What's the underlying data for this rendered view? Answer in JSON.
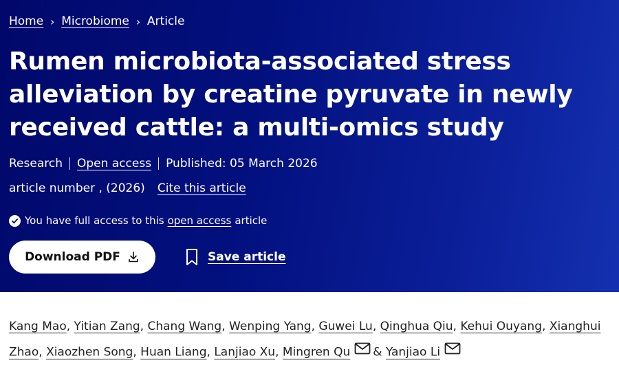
{
  "breadcrumb": {
    "home": "Home",
    "section": "Microbiome",
    "current": "Article",
    "separator": "›"
  },
  "article": {
    "title": "Rumen microbiota-associated stress alleviation by creatine pyruvate in newly received cattle: a multi-omics study",
    "type": "Research",
    "access_label": "Open access",
    "published": "Published: 05 March 2026",
    "article_number": "article number , (2026)",
    "cite_label": "Cite this article"
  },
  "access_notice": {
    "prefix": "You have full access to this",
    "link": "open access",
    "suffix": "article"
  },
  "actions": {
    "download_label": "Download PDF",
    "save_label": "Save article"
  },
  "authors": [
    {
      "name": "Kang Mao",
      "sep": ","
    },
    {
      "name": "Yitian Zang",
      "sep": ","
    },
    {
      "name": "Chang Wang",
      "sep": ","
    },
    {
      "name": "Wenping Yang",
      "sep": ","
    },
    {
      "name": "Guwei Lu",
      "sep": ","
    },
    {
      "name": "Qinghua Qiu",
      "sep": ","
    },
    {
      "name": "Kehui Ouyang",
      "sep": ","
    },
    {
      "name": "Xianghui Zhao",
      "sep": ","
    },
    {
      "name": "Xiaozhen Song",
      "sep": ","
    },
    {
      "name": "Huan Liang",
      "sep": ","
    },
    {
      "name": "Lanjiao Xu",
      "sep": ","
    },
    {
      "name": "Mingren Qu",
      "sep": "&",
      "mail": true
    },
    {
      "name": "Yanjiao Li",
      "sep": "",
      "mail": true
    }
  ],
  "colors": {
    "hero_bg": "#02107e",
    "text_on_hero": "#ffffff"
  },
  "icons": {
    "check": "check-circle-icon",
    "download": "download-icon",
    "save": "bookmark-icon",
    "mail": "envelope-icon"
  }
}
